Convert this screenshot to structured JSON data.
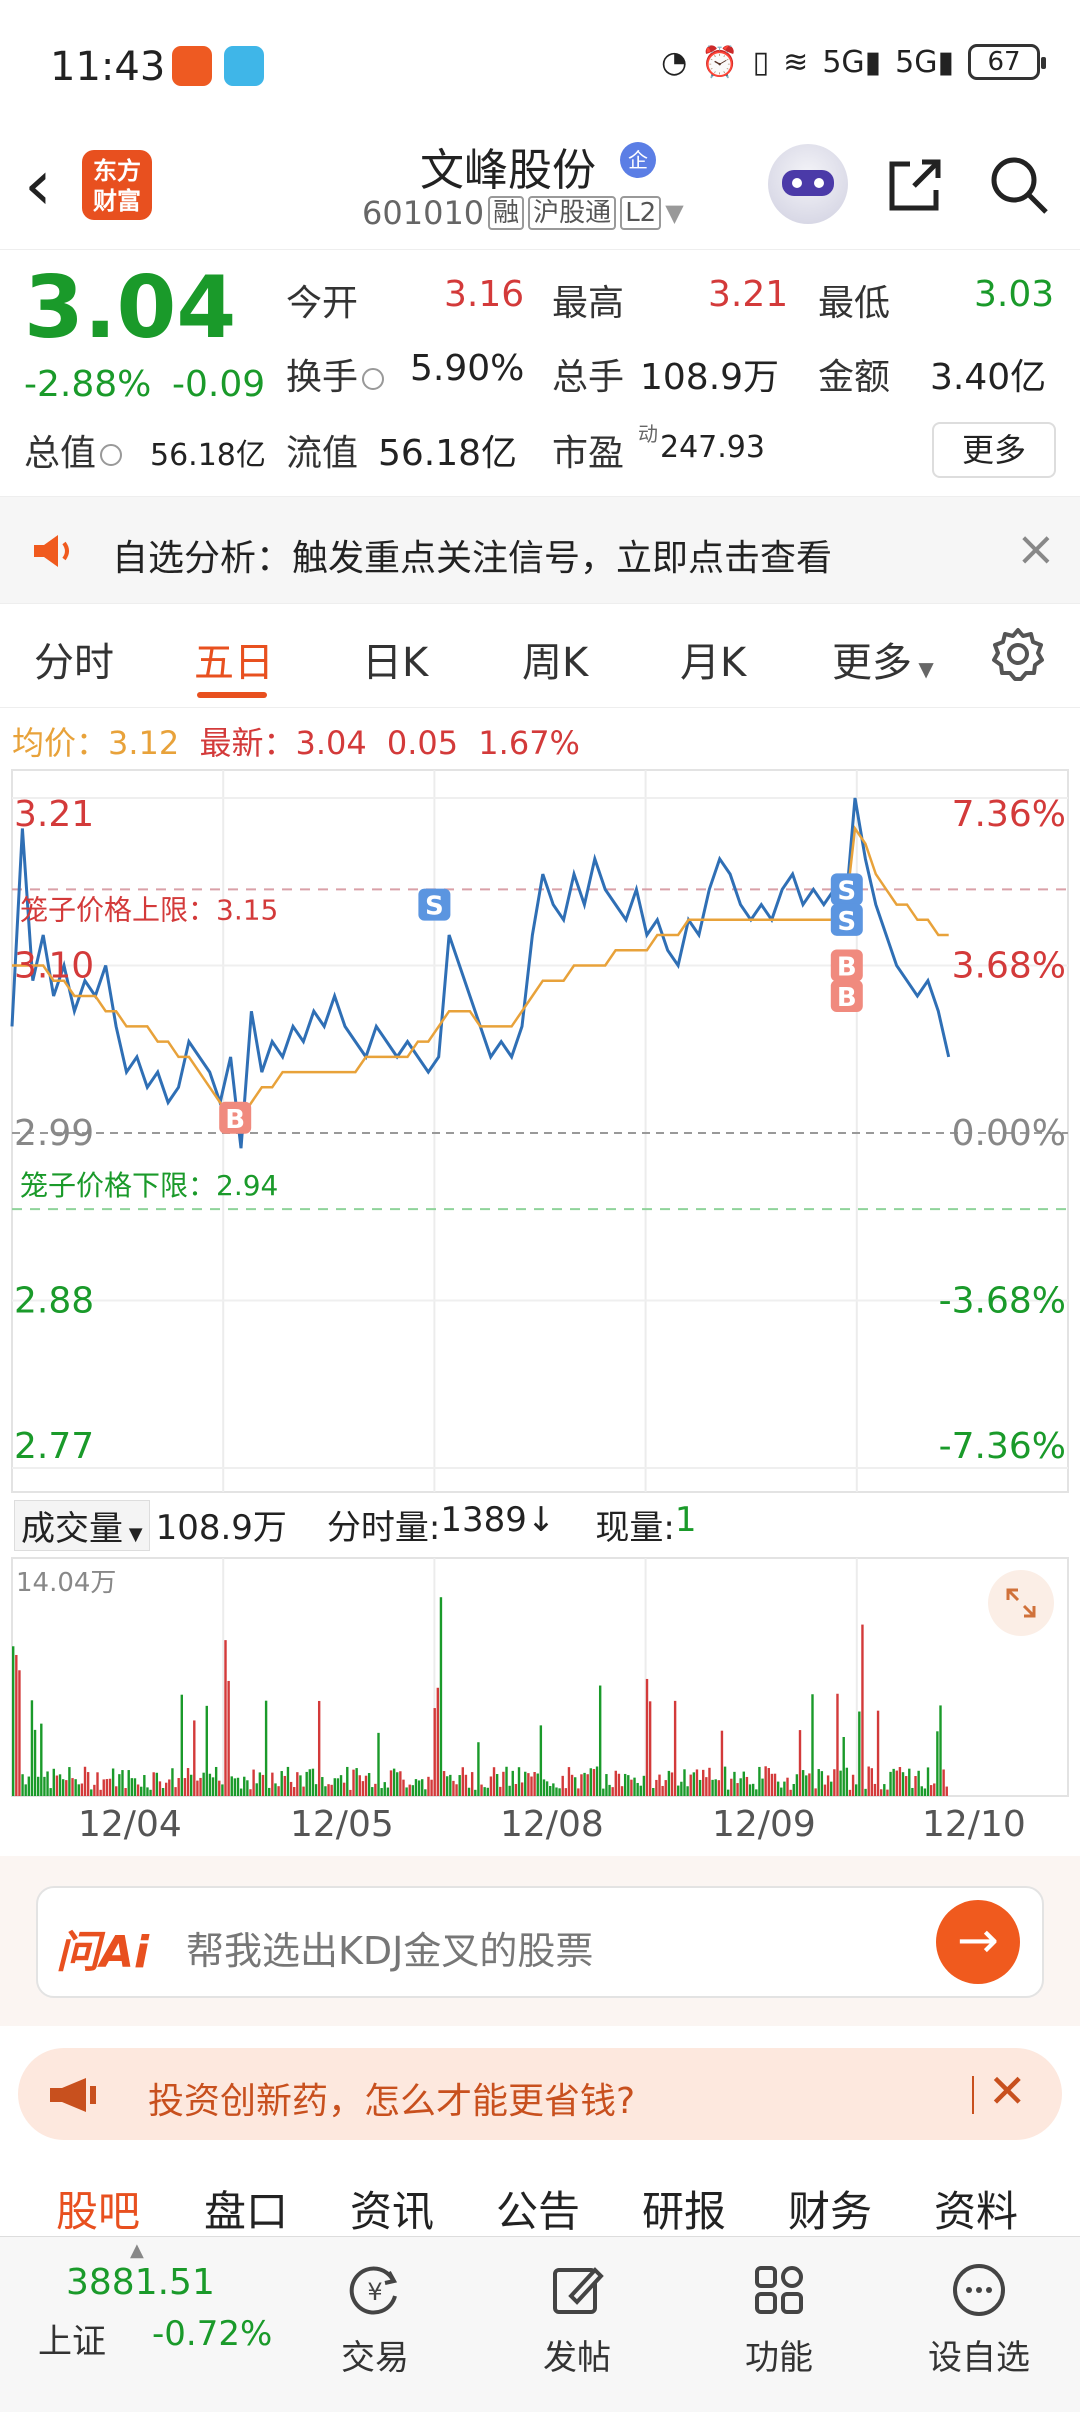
{
  "status_bar": {
    "time": "11:43",
    "battery": "67"
  },
  "header": {
    "stock_name": "文峰股份",
    "badge": "企",
    "logo_text": "东方财富",
    "code": "601010",
    "tags": [
      "融",
      "沪股通",
      "L2"
    ]
  },
  "quote": {
    "price": "3.04",
    "change_pct": "-2.88%",
    "change": "-0.09",
    "open_label": "今开",
    "open": "3.16",
    "high_label": "最高",
    "high": "3.21",
    "low_label": "最低",
    "low": "3.03",
    "turnover_label": "换手",
    "turnover": "5.90%",
    "volume_label": "总手",
    "volume": "108.9万",
    "amount_label": "金额",
    "amount": "3.40亿",
    "mktcap_label": "总值",
    "mktcap": "56.18亿",
    "float_label": "流值",
    "float": "56.18亿",
    "pe_label": "市盈",
    "pe_sup": "动",
    "pe": "247.93",
    "more": "更多"
  },
  "notice": {
    "text": "自选分析：触发重点关注信号，立即点击查看"
  },
  "tabs": [
    "分时",
    "五日",
    "日K",
    "周K",
    "月K",
    "更多"
  ],
  "active_tab": "五日",
  "chart_info": {
    "avg_label": "均价：",
    "avg": "3.12",
    "latest_label": "最新：",
    "latest": "3.04",
    "latest_chg": "0.05",
    "latest_pct": "1.67%"
  },
  "chart_data": {
    "type": "line",
    "y_ticks_left": [
      "3.21",
      "3.10",
      "2.99",
      "2.88",
      "2.77"
    ],
    "y_ticks_right": [
      "7.36%",
      "3.68%",
      "0.00%",
      "-3.68%",
      "-7.36%"
    ],
    "ylim": [
      2.77,
      3.21
    ],
    "cage_upper_label": "笼子价格上限：",
    "cage_upper": "3.15",
    "cage_lower_label": "笼子价格下限：",
    "cage_lower": "2.94",
    "x_categories": [
      "12/04",
      "12/05",
      "12/08",
      "12/09",
      "12/10"
    ],
    "series": [
      {
        "name": "price",
        "color": "#2f6fb5",
        "values": [
          3.06,
          3.19,
          3.09,
          3.12,
          3.08,
          3.1,
          3.07,
          3.09,
          3.08,
          3.1,
          3.06,
          3.03,
          3.04,
          3.02,
          3.03,
          3.01,
          3.02,
          3.05,
          3.04,
          3.03,
          3.01,
          3.04,
          2.98,
          3.07,
          3.03,
          3.05,
          3.04,
          3.06,
          3.05,
          3.07,
          3.06,
          3.08,
          3.06,
          3.05,
          3.04,
          3.06,
          3.05,
          3.04,
          3.05,
          3.04,
          3.03,
          3.04,
          3.12,
          3.1,
          3.08,
          3.06,
          3.04,
          3.05,
          3.04,
          3.06,
          3.12,
          3.16,
          3.14,
          3.13,
          3.16,
          3.14,
          3.17,
          3.15,
          3.14,
          3.13,
          3.15,
          3.12,
          3.13,
          3.11,
          3.1,
          3.13,
          3.12,
          3.15,
          3.17,
          3.16,
          3.14,
          3.13,
          3.14,
          3.13,
          3.15,
          3.16,
          3.14,
          3.15,
          3.14,
          3.15,
          3.13,
          3.21,
          3.17,
          3.14,
          3.12,
          3.1,
          3.09,
          3.08,
          3.09,
          3.07,
          3.04
        ]
      },
      {
        "name": "avg",
        "color": "#e8a23a",
        "values": [
          3.1,
          3.1,
          3.1,
          3.1,
          3.09,
          3.09,
          3.08,
          3.08,
          3.08,
          3.07,
          3.07,
          3.06,
          3.06,
          3.06,
          3.05,
          3.05,
          3.04,
          3.04,
          3.03,
          3.02,
          3.01,
          3.0,
          3.0,
          3.01,
          3.02,
          3.02,
          3.03,
          3.03,
          3.03,
          3.03,
          3.03,
          3.03,
          3.03,
          3.03,
          3.04,
          3.04,
          3.04,
          3.04,
          3.04,
          3.05,
          3.05,
          3.06,
          3.07,
          3.07,
          3.07,
          3.06,
          3.06,
          3.06,
          3.06,
          3.07,
          3.08,
          3.09,
          3.09,
          3.09,
          3.1,
          3.1,
          3.1,
          3.1,
          3.11,
          3.11,
          3.11,
          3.11,
          3.12,
          3.12,
          3.12,
          3.13,
          3.13,
          3.13,
          3.13,
          3.13,
          3.13,
          3.13,
          3.13,
          3.13,
          3.13,
          3.13,
          3.13,
          3.13,
          3.13,
          3.13,
          3.13,
          3.19,
          3.18,
          3.16,
          3.15,
          3.14,
          3.14,
          3.13,
          3.13,
          3.12,
          3.12
        ]
      }
    ],
    "trade_marks": [
      {
        "label": "B",
        "day": 1,
        "value": 3.0
      },
      {
        "label": "S",
        "day": 2,
        "value": 3.14
      },
      {
        "label": "S",
        "day": 4,
        "value": 3.15
      },
      {
        "label": "S",
        "day": 4,
        "value": 3.13
      },
      {
        "label": "B",
        "day": 4,
        "value": 3.1
      },
      {
        "label": "B",
        "day": 4,
        "value": 3.08
      }
    ]
  },
  "volume": {
    "label": "成交量",
    "total": "108.9万",
    "minute_label": "分时量:",
    "minute": "1389",
    "current_label": "现量:",
    "current": "1",
    "max_label": "14.04万"
  },
  "ask_ai": {
    "logo": "问Ai",
    "placeholder": "帮我选出KDJ金叉的股票"
  },
  "promo": {
    "text": "投资创新药，怎么才能更省钱?"
  },
  "sub_tabs": [
    "股吧",
    "盘口",
    "资讯",
    "公告",
    "研报",
    "财务",
    "资料"
  ],
  "bottom_bar": {
    "index_value": "3881.51",
    "index_name": "上证",
    "index_change": "-0.72%",
    "items": [
      "交易",
      "发帖",
      "功能",
      "设自选"
    ]
  }
}
